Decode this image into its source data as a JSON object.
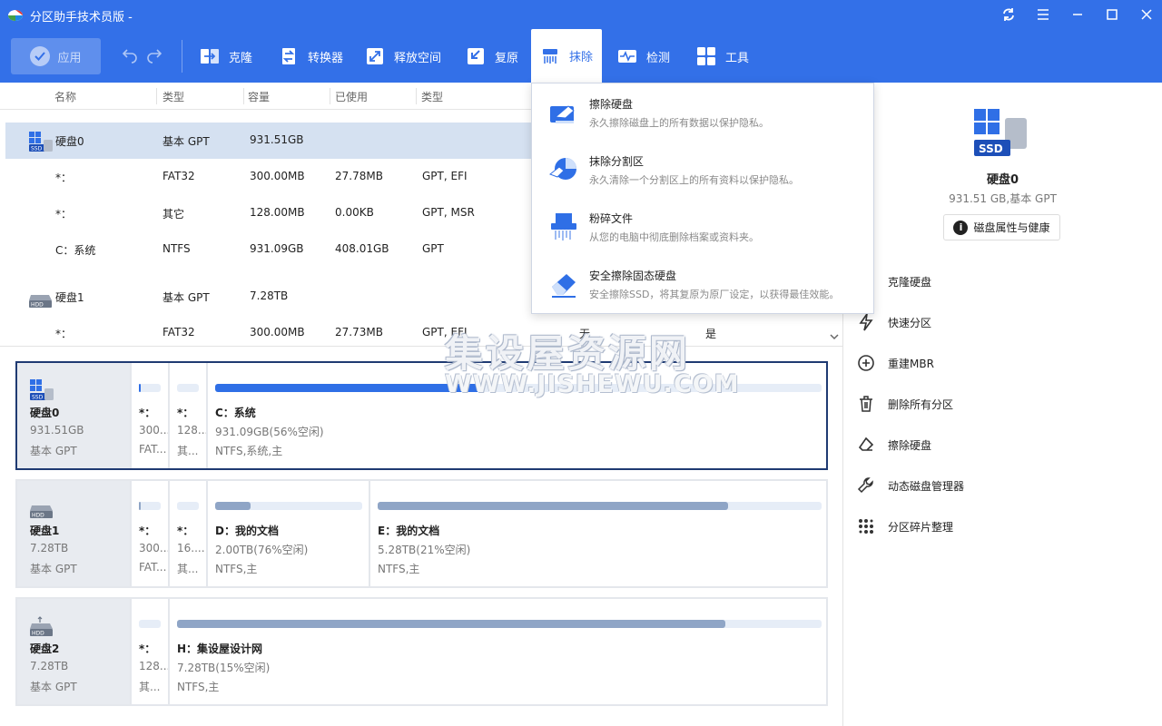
{
  "window": {
    "title": "分区助手技术员版 -"
  },
  "toolbar": {
    "apply_label": "应用",
    "items": [
      {
        "label": "克隆",
        "icon": "clone-icon"
      },
      {
        "label": "转换器",
        "icon": "convert-icon"
      },
      {
        "label": "释放空间",
        "icon": "free-space-icon"
      },
      {
        "label": "复原",
        "icon": "restore-icon"
      },
      {
        "label": "抹除",
        "icon": "wipe-icon",
        "active": true
      },
      {
        "label": "检测",
        "icon": "check-icon"
      },
      {
        "label": "工具",
        "icon": "tools-icon"
      }
    ]
  },
  "table": {
    "headers": [
      "名称",
      "类型",
      "容量",
      "已使用",
      "类型"
    ],
    "rows": [
      {
        "name": "硬盘0",
        "type": "基本 GPT",
        "capacity": "931.51GB",
        "used": "",
        "ptype": "",
        "disk": "SSD",
        "selected": true
      },
      {
        "name": "*：",
        "type": "FAT32",
        "capacity": "300.00MB",
        "used": "27.78MB",
        "ptype": "GPT, EFI"
      },
      {
        "name": "*：",
        "type": "其它",
        "capacity": "128.00MB",
        "used": "0.00KB",
        "ptype": "GPT, MSR"
      },
      {
        "name": "C：系统",
        "type": "NTFS",
        "capacity": "931.09GB",
        "used": "408.01GB",
        "ptype": "GPT"
      },
      {
        "name": "硬盘1",
        "type": "基本 GPT",
        "capacity": "7.28TB",
        "used": "",
        "ptype": "",
        "disk": "HDD"
      },
      {
        "name": "*：",
        "type": "FAT32",
        "capacity": "300.00MB",
        "used": "27.73MB",
        "ptype": "GPT, EFI",
        "extra1": "无",
        "extra2": "是"
      }
    ]
  },
  "diskmap": [
    {
      "name": "硬盘0",
      "size": "931.51GB",
      "type": "基本 GPT",
      "disk": "SSD",
      "selected": true,
      "parts": [
        {
          "name": "*：",
          "info": "300...",
          "fs": "FAT...",
          "used": 0.1
        },
        {
          "name": "*：",
          "info": "128...",
          "fs": "其...",
          "used": 0
        },
        {
          "name": "C：系统",
          "info": "931.09GB(56%空闲)",
          "fs": "NTFS,系统,主",
          "used": 0.44,
          "color": "#2f6fe6"
        }
      ]
    },
    {
      "name": "硬盘1",
      "size": "7.28TB",
      "type": "基本 GPT",
      "disk": "HDD",
      "parts": [
        {
          "name": "*：",
          "info": "300...",
          "fs": "FAT...",
          "used": 0.1
        },
        {
          "name": "*：",
          "info": "16....",
          "fs": "其...",
          "used": 0
        },
        {
          "name": "D：我的文档",
          "info": "2.00TB(76%空闲)",
          "fs": "NTFS,主",
          "used": 0.24,
          "color": "#8fa5c6"
        },
        {
          "name": "E：我的文档",
          "info": "5.28TB(21%空闲)",
          "fs": "NTFS,主",
          "used": 0.79,
          "color": "#8fa5c6"
        }
      ]
    },
    {
      "name": "硬盘2",
      "size": "7.28TB",
      "type": "基本 GPT",
      "disk": "HDD",
      "parts": [
        {
          "name": "*：",
          "info": "128...",
          "fs": "其...",
          "used": 0
        },
        {
          "name": "H：集设屋设计网",
          "info": "7.28TB(15%空闲)",
          "fs": "NTFS,主",
          "used": 0.85,
          "color": "#8fa5c6"
        }
      ]
    }
  ],
  "right_panel": {
    "disk_name": "硬盘0",
    "disk_info": "931.51 GB,基本 GPT",
    "props_button": "磁盘属性与健康",
    "actions": [
      {
        "label": "克隆硬盘",
        "icon": "clone-disk-icon"
      },
      {
        "label": "快速分区",
        "icon": "quick-partition-icon"
      },
      {
        "label": "重建MBR",
        "icon": "rebuild-mbr-icon"
      },
      {
        "label": "删除所有分区",
        "icon": "trash-icon"
      },
      {
        "label": "擦除硬盘",
        "icon": "eraser-icon"
      },
      {
        "label": "动态磁盘管理器",
        "icon": "wrench-icon"
      },
      {
        "label": "分区碎片整理",
        "icon": "defrag-icon"
      }
    ]
  },
  "dropdown": [
    {
      "title": "擦除硬盘",
      "desc": "永久擦除磁盘上的所有数据以保护隐私。",
      "icon": "wipe-disk-icon"
    },
    {
      "title": "抹除分割区",
      "desc": "永久清除一个分割区上的所有资料以保护隐私。",
      "icon": "wipe-partition-icon"
    },
    {
      "title": "粉碎文件",
      "desc": "从您的电脑中彻底删除档案或资料夹。",
      "icon": "shred-file-icon"
    },
    {
      "title": "安全擦除固态硬盘",
      "desc": "安全擦除SSD，将其复原为原厂设定，以获得最佳效能。",
      "icon": "ssd-erase-icon"
    }
  ],
  "watermark": {
    "cn": "集设屋资源网",
    "en": "WWW.JISHEWU.COM"
  }
}
